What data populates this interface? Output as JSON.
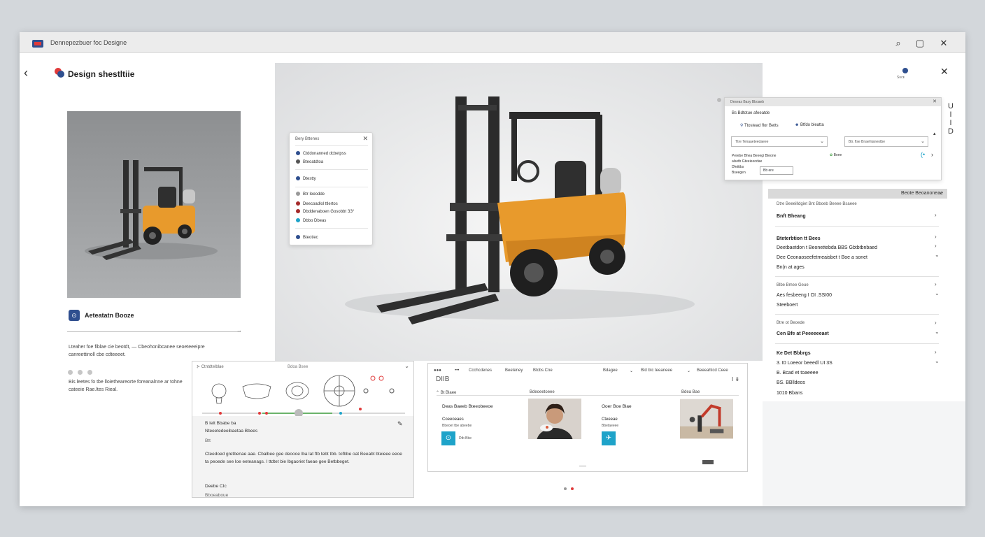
{
  "window": {
    "title": "Dennepezbuer foc Designe",
    "buttons": {
      "search": "⌕",
      "lock": "▢",
      "close": "✕"
    }
  },
  "header": {
    "back": "‹",
    "title": "Design shestltiie",
    "close": "✕",
    "right_label": "Sᴜᴄᴇ",
    "vertical_text": [
      "U",
      "I",
      "I",
      "D"
    ]
  },
  "left": {
    "info_label": "Aeteatatn Booze",
    "info_icon": "⊙",
    "desc1": "Lteaher foe fiblae cie beotdt, — Cbeohonibcanee seoeteeeipre canreettinoll cbe cdteeeet.",
    "desc2": "Bis leetes fo tbe lloietheareorte foreanalnne ar tohne cateeie Rae.ltes Rieal."
  },
  "popup": {
    "title": "Bery Bttenes",
    "close": "✕",
    "items": [
      {
        "label": "Ctddonanned dcbetpss",
        "color": "#2f4f8f"
      },
      {
        "label": "Bteoatdtoa",
        "color": "#555555"
      },
      {
        "label": "Dtestty",
        "color": "#2f4f8f"
      },
      {
        "label": "Btr Ieeodde",
        "color": "#999999"
      },
      {
        "label": "Deecoadlol ttlertos",
        "color": "#a52a2a"
      },
      {
        "label": "Dbddenaboen Gosobbt  ЗЗ°",
        "color": "#a52a2a"
      },
      {
        "label": "Dbbo Dbeas",
        "color": "#1ea3c9"
      },
      {
        "label": "Bteotiec",
        "color": "#2f4f8f"
      }
    ]
  },
  "config": {
    "bar_title": "Deseas Basy Bboaeb",
    "bar_close": "✕",
    "subtitle": "Bs Bdtotue afeeatde",
    "opt1": "Ttostead flor Betts",
    "opt2": "Btfdo bleatta",
    "select1": "Ttre Tenaaeteedaeee",
    "select2": "Btr. flse Bnaehtaneotbe",
    "left_text": [
      "Perebe  Bhea Beeegi Bteone",
      "alsetb Gteeieeodae",
      "Dfetttbs",
      "Bseegen"
    ],
    "badge": "Boee",
    "pill": "Bb   ere",
    "ctrl": "(•",
    "arrow": "›"
  },
  "accordion": {
    "header": "Beote Beoanoneae",
    "sub": "Dtre Beeeilldgiet     Bnt Bboeb Beeee Bsaeee",
    "items": [
      {
        "text": "Bnft Bheang",
        "bold": true
      },
      {
        "text": "Bteterbtion tt Bees",
        "bold": true
      },
      {
        "text": "Deetbaetdon t Beonettebda BBS Gbtbtbnbaed",
        "bold": false
      },
      {
        "text": "Dee Ceonaoseefetmeaisbet t Boe a sonet",
        "bold": false
      },
      {
        "text": "Bn(n at ages",
        "bold": false
      },
      {
        "text": "Blbe Bmee Geue",
        "bold": false
      },
      {
        "text": "Aes fesbeeng I OI .SSI00",
        "bold": false
      },
      {
        "text": "Steeboert",
        "bold": false
      },
      {
        "text": "Btre ot Beoede",
        "bold": false
      },
      {
        "text": "Cen Bfe at Peeeeeeaet",
        "bold": true
      },
      {
        "text": "Ke Det Bbbrgs",
        "bold": true
      },
      {
        "text": "3. t0 Loeeor beeedl UI 3S",
        "bold": false
      },
      {
        "text": "B. Bcad et toaeeee",
        "bold": false
      },
      {
        "text": "BS. BBlldeos",
        "bold": false
      },
      {
        "text": "1010 Bbans",
        "bold": false
      }
    ],
    "chev_right": "›",
    "chev_down": "⌄"
  },
  "diagram": {
    "head_left": "⊱ Ctntdtelblae",
    "head_mid": "Bdoa Bsee",
    "close": "⌄",
    "title": "B Ielt Bbabe ba",
    "subtitle": "Nteeetedeeibaetaa Bbees",
    "tag": "Btt",
    "edit": "✎",
    "para": "Cteedoed gretbenae aae. Cbalbee gee deoooe lba lat ftb tebt tbb. tofbbe oat Beeabt bteieee eeoe ta peoede see loe eeteanags. I ttdtet bie lbgaoriet faeae gee Betbbeget.",
    "footer1": "Deebe CIc",
    "footer2": "Bboeaboue"
  },
  "products": {
    "nav": [
      "●●●",
      "•••",
      "Ccchcdenes",
      "Beeteney",
      "Btcbs Cne",
      "Bdagee",
      "⌄",
      "Bld btc teeaneee",
      "⌄",
      "Beeeahtcd Ceee"
    ],
    "big": "DIIB",
    "big_right": "I ⇟",
    "col_heads": [
      "⌃  Bt Blaee",
      "Bdeoeetoeee",
      "Bdea Bae"
    ],
    "card1": {
      "title": "Deas  Baeeb Bteeobeeoe",
      "sub": "Coeeoeaes",
      "sub2": "Bbeoet tbe abeebe",
      "icon": "⊙",
      "icon_label": "Dtb Bbe"
    },
    "card2": {
      "title": "Ooer Boe Blae",
      "sub": "Cteeeae",
      "sub2": "Bbetaeeee",
      "icon": "✈"
    }
  },
  "colors": {
    "brand": "#2f4f8f",
    "accent": "#e03a3a",
    "teal": "#1ea3c9",
    "forklift": "#e89a2c"
  }
}
